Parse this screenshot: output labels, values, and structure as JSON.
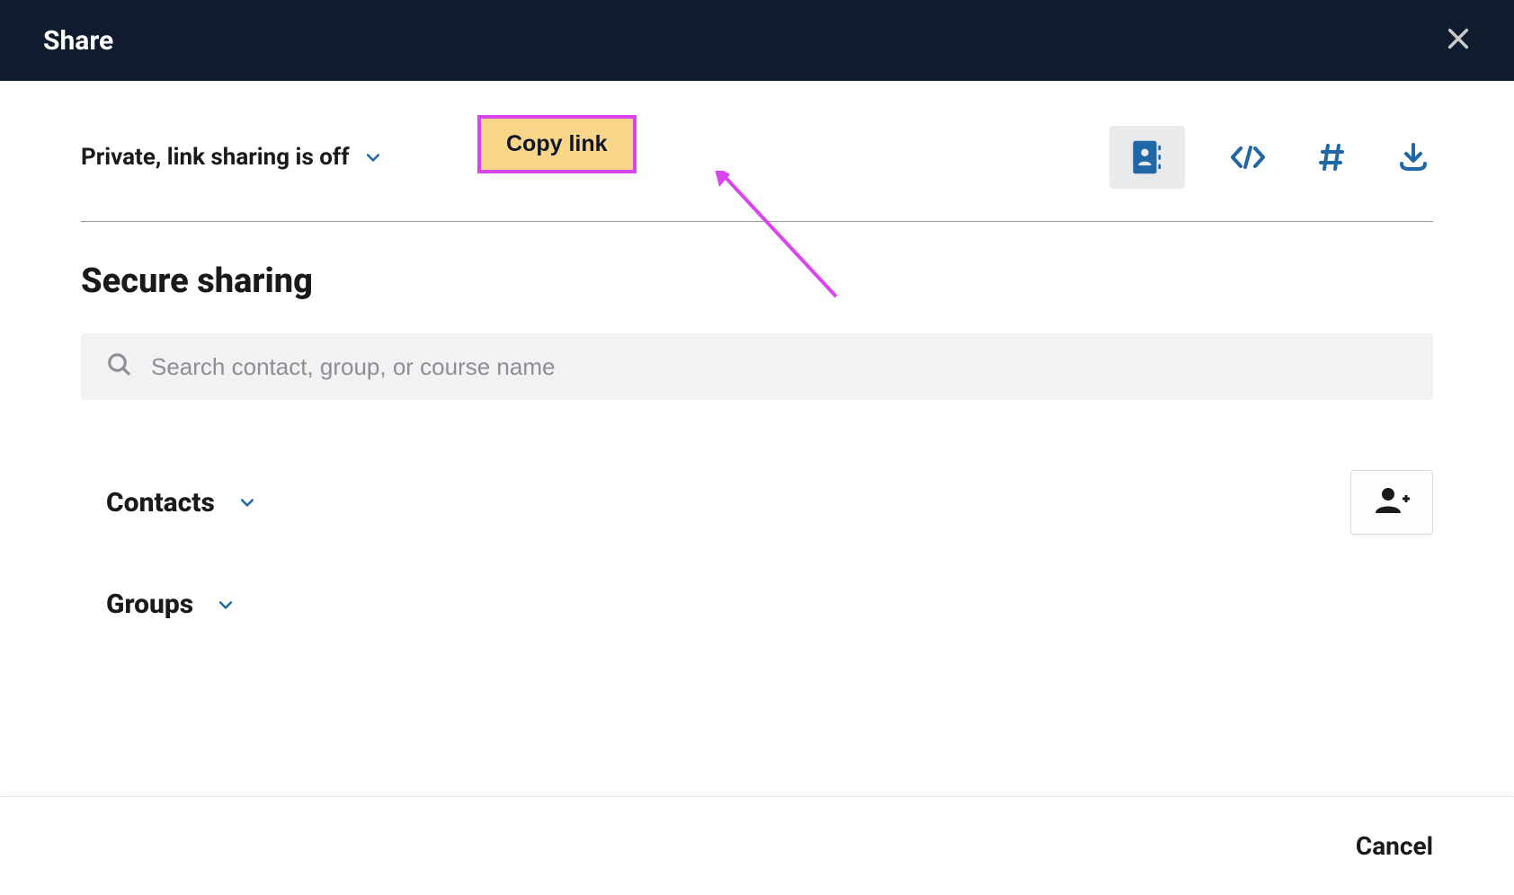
{
  "header": {
    "title": "Share"
  },
  "privacy": {
    "label": "Private, link sharing is off"
  },
  "copy_link": {
    "label": "Copy link"
  },
  "icons": {
    "contact_card": "contact-card-icon",
    "embed": "embed-icon",
    "hash": "hash-icon",
    "download": "download-icon"
  },
  "secure_sharing": {
    "title": "Secure sharing"
  },
  "search": {
    "placeholder": "Search contact, group, or course name"
  },
  "sections": {
    "contacts": "Contacts",
    "groups": "Groups"
  },
  "footer": {
    "cancel": "Cancel"
  },
  "colors": {
    "accent_blue": "#1f67a6",
    "highlight_bg": "#f9d58a",
    "highlight_border": "#d946ef",
    "header_bg": "#0f1c2e"
  }
}
